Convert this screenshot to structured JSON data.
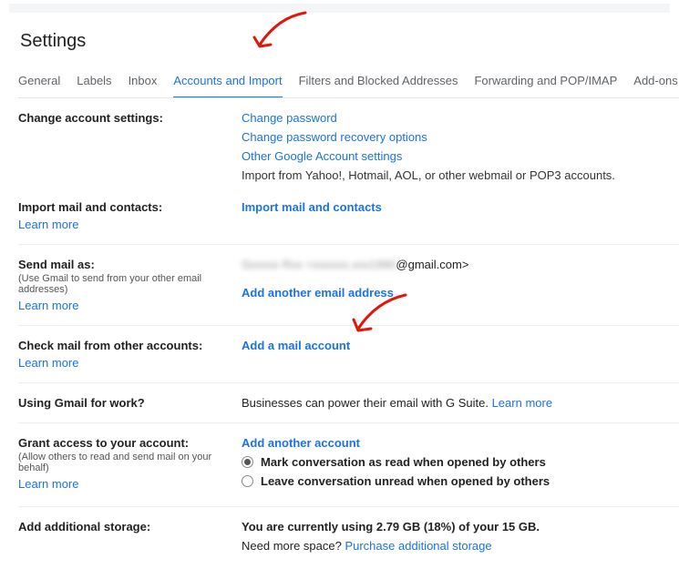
{
  "page": {
    "title": "Settings"
  },
  "tabs": {
    "general": "General",
    "labels": "Labels",
    "inbox": "Inbox",
    "accounts": "Accounts and Import",
    "filters": "Filters and Blocked Addresses",
    "forwarding": "Forwarding and POP/IMAP",
    "addons": "Add-ons"
  },
  "changeAccount": {
    "title": "Change account settings:",
    "changePassword": "Change password",
    "recovery": "Change password recovery options",
    "other": "Other Google Account settings"
  },
  "importMail": {
    "title": "Import mail and contacts:",
    "desc": "Import from Yahoo!, Hotmail, AOL, or other webmail or POP3 accounts.",
    "action": "Import mail and contacts",
    "learnMore": "Learn more"
  },
  "sendAs": {
    "title": "Send mail as:",
    "hint": "(Use Gmail to send from your other email addresses)",
    "learnMore": "Learn more",
    "nameRedacted": "Sxxxxx Rxx",
    "emailRedactedPrefix": "<xxxxxx.xxx1990",
    "emailSuffix": "@gmail.com>",
    "addAnother": "Add another email address"
  },
  "checkMail": {
    "title": "Check mail from other accounts:",
    "learnMore": "Learn more",
    "action": "Add a mail account"
  },
  "work": {
    "title": "Using Gmail for work?",
    "desc": "Businesses can power their email with G Suite. ",
    "learnMore": "Learn more"
  },
  "grant": {
    "title": "Grant access to your account:",
    "hint": "(Allow others to read and send mail on your behalf)",
    "learnMore": "Learn more",
    "action": "Add another account",
    "radio1": "Mark conversation as read when opened by others",
    "radio2": "Leave conversation unread when opened by others"
  },
  "storage": {
    "title": "Add additional storage:",
    "line1": "You are currently using 2.79 GB (18%) of your 15 GB.",
    "line2a": "Need more space? ",
    "purchase": "Purchase additional storage"
  }
}
